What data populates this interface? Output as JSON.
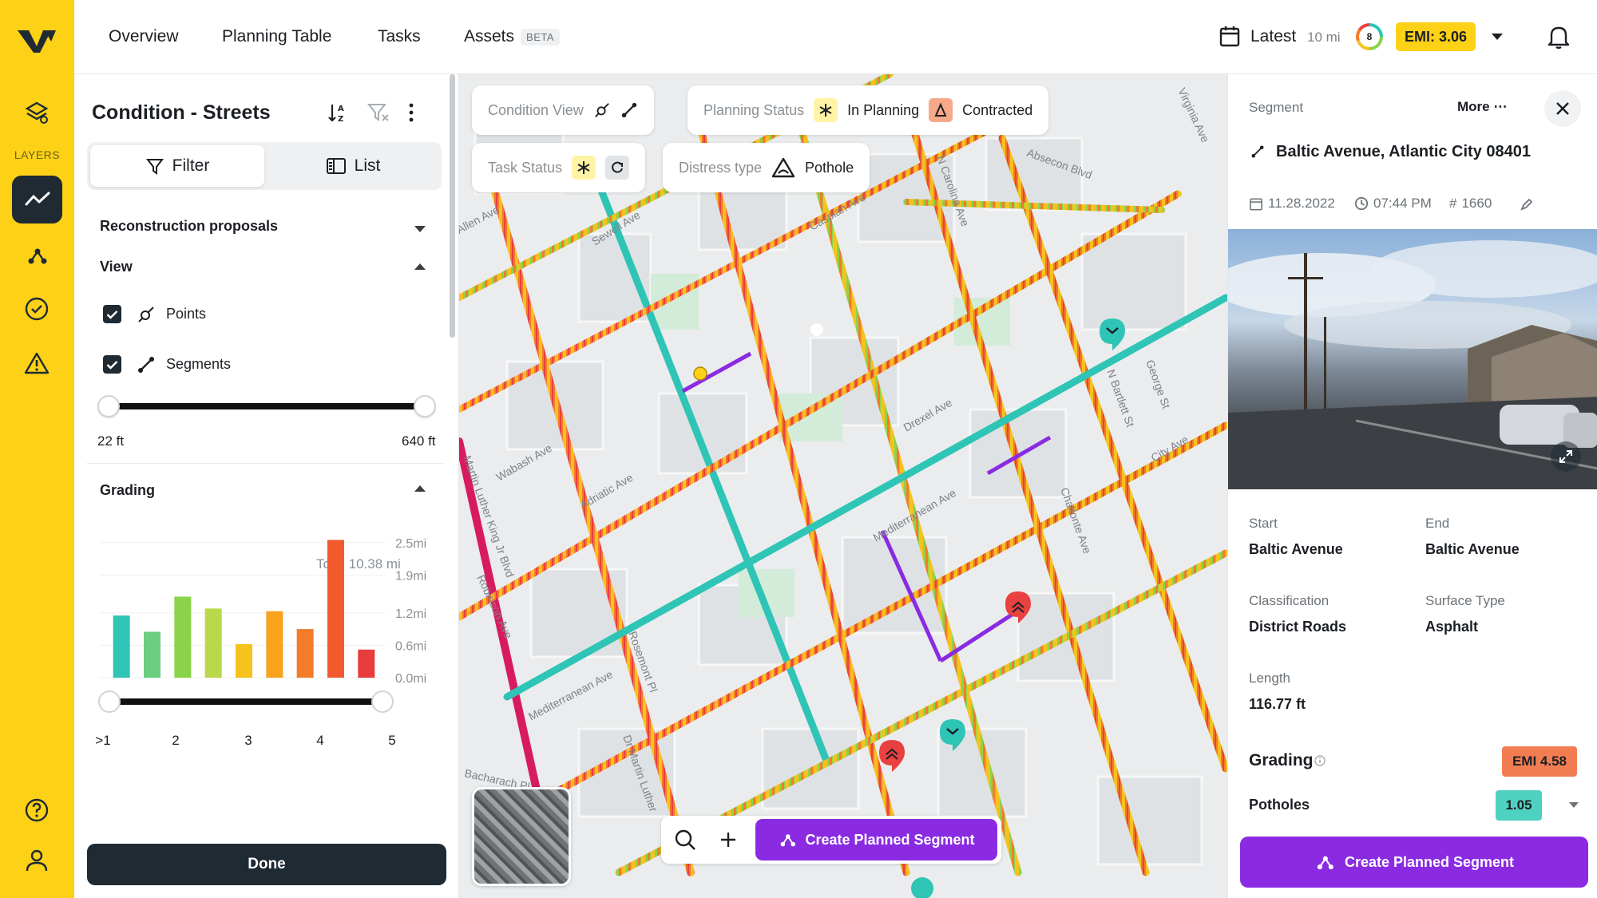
{
  "nav": {
    "items": [
      "Overview",
      "Planning Table",
      "Tasks",
      "Assets"
    ],
    "beta": "BETA",
    "latest_label": "Latest",
    "latest_dist": "10 mi",
    "ring_value": "8",
    "emi_badge": "EMI: 3.06"
  },
  "rail": {
    "layers_label": "LAYERS",
    "icons": [
      "layers-icon",
      "condition-icon",
      "segments-icon",
      "tasks-icon",
      "distress-icon",
      "help-icon",
      "user-icon"
    ]
  },
  "panel": {
    "title": "Condition - Streets",
    "filter_label": "Filter",
    "list_label": "List",
    "recon_label": "Reconstruction proposals",
    "view_label": "View",
    "points_label": "Points",
    "segments_label": "Segments",
    "range_min": "22 ft",
    "range_max": "640 ft",
    "grading_label": "Grading",
    "grading_total": "Total 10.38 mi",
    "done_label": "Done"
  },
  "chart_data": {
    "type": "bar",
    "categories": [
      ">1",
      "",
      "2",
      "",
      "3",
      "",
      "4",
      "",
      "5",
      ""
    ],
    "x_tick_labels": [
      ">1",
      "2",
      "3",
      "4",
      "5"
    ],
    "values": [
      1.15,
      0.85,
      1.5,
      1.28,
      0.62,
      1.23,
      0.9,
      2.55,
      0.52
    ],
    "bar_colors": [
      "#2ec4b6",
      "#6bcf7f",
      "#8bd34a",
      "#b9d84a",
      "#f6c21c",
      "#f8a21e",
      "#f47b2a",
      "#f25a2e",
      "#e93c3c"
    ],
    "y_tick_labels": [
      "2.5mi",
      "1.9mi",
      "1.2mi",
      "0.6mi",
      "0.0mi"
    ],
    "ylim": [
      0,
      2.6
    ],
    "grid": true,
    "title": "",
    "xlabel": "",
    "ylabel": ""
  },
  "map": {
    "condition_view": "Condition View",
    "planning_status": "Planning Status",
    "in_planning": "In Planning",
    "contracted": "Contracted",
    "task_status": "Task Status",
    "distress_type": "Distress type",
    "pothole": "Pothole",
    "create_btn": "Create Planned Segment",
    "streets": [
      "Sewell Ave",
      "Caspian Ave",
      "Adriatic Ave",
      "Wabash Ave",
      "Drexel Ave",
      "Mediterranean Ave",
      "Robinson Ave",
      "Bacharach Pl",
      "Rosemont Pl",
      "N Carolina Ave",
      "Chalfonte Ave",
      "N Bartlett St",
      "George St",
      "City Ave",
      "Virginia Ave",
      "Absecon Blvd",
      "Martin Luther King Jr Blvd",
      "Dr Martin Luther",
      "Mediterranean Ave",
      "Allen Ave"
    ]
  },
  "segment": {
    "header": "Segment",
    "more": "More",
    "title": "Baltic Avenue, Atlantic City 08401",
    "date": "11.28.2022",
    "time": "07:44 PM",
    "id": "1660",
    "start_label": "Start",
    "start_val": "Baltic Avenue",
    "end_label": "End",
    "end_val": "Baltic Avenue",
    "class_label": "Classification",
    "class_val": "District Roads",
    "surface_label": "Surface Type",
    "surface_val": "Asphalt",
    "length_label": "Length",
    "length_val": "116.77 ft",
    "grading_label": "Grading",
    "emi_badge": "EMI 4.58",
    "potholes_label": "Potholes",
    "potholes_val": "1.05",
    "create_btn": "Create Planned Segment"
  },
  "colors": {
    "brand_yellow": "#fcd116",
    "dark": "#1f2a33",
    "purple": "#8a2be2"
  }
}
